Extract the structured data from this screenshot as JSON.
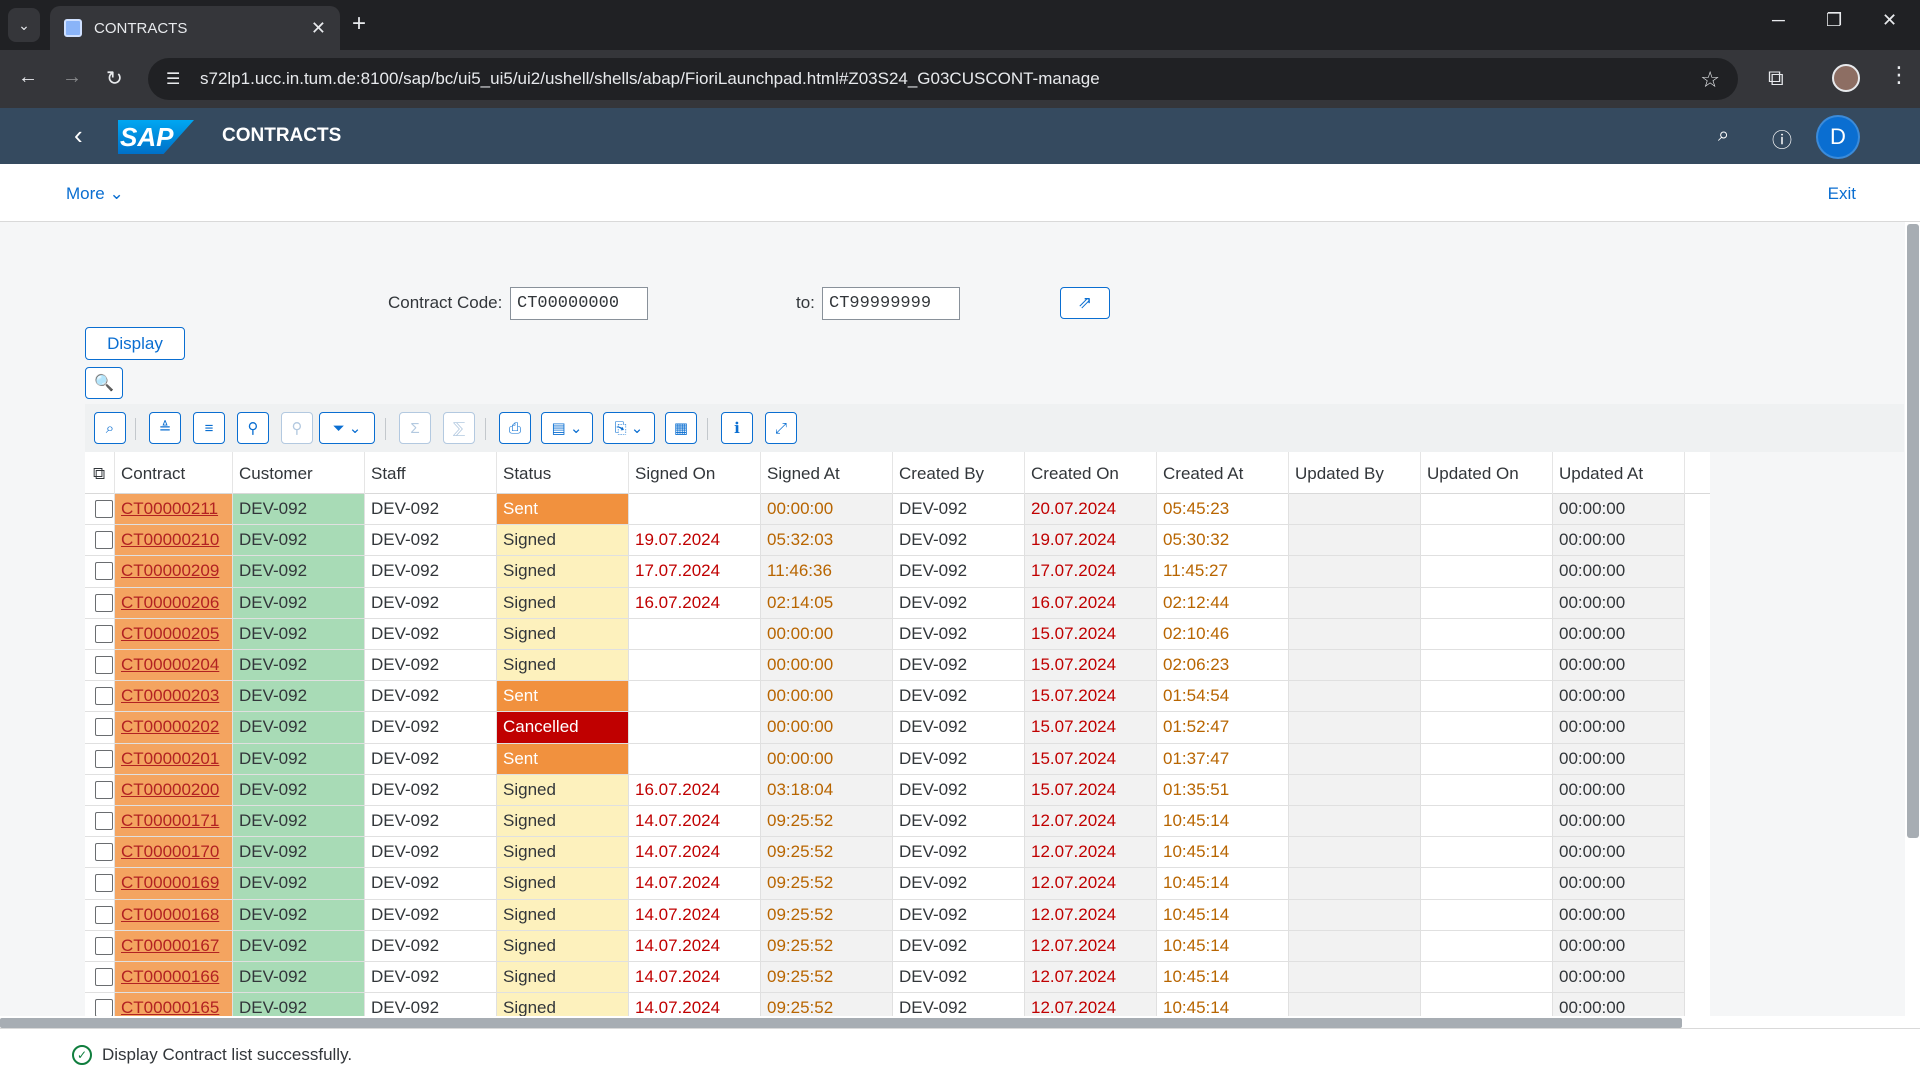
{
  "browser": {
    "tab_title": "CONTRACTS",
    "url": "s72lp1.ucc.in.tum.de:8100/sap/bc/ui5_ui5/ui2/ushell/shells/abap/FioriLaunchpad.html#Z03S24_G03CUSCONT-manage"
  },
  "shell": {
    "logo_text": "SAP",
    "title": "CONTRACTS",
    "avatar_initial": "D"
  },
  "subheader": {
    "more_label": "More",
    "exit_label": "Exit"
  },
  "selection": {
    "contract_code_label": "Contract Code:",
    "contract_from": "CT00000000",
    "to_label": "to:",
    "contract_to": "CT99999999",
    "display_button": "Display"
  },
  "grid": {
    "columns": [
      "Contract",
      "Customer",
      "Staff",
      "Status",
      "Signed On",
      "Signed At",
      "Created By",
      "Created On",
      "Created At",
      "Updated By",
      "Updated On",
      "Updated At"
    ],
    "rows": [
      [
        "CT00000211",
        "DEV-092",
        "DEV-092",
        "Sent",
        "",
        "00:00:00",
        "DEV-092",
        "20.07.2024",
        "05:45:23",
        "",
        "",
        "00:00:00"
      ],
      [
        "CT00000210",
        "DEV-092",
        "DEV-092",
        "Signed",
        "19.07.2024",
        "05:32:03",
        "DEV-092",
        "19.07.2024",
        "05:30:32",
        "",
        "",
        "00:00:00"
      ],
      [
        "CT00000209",
        "DEV-092",
        "DEV-092",
        "Signed",
        "17.07.2024",
        "11:46:36",
        "DEV-092",
        "17.07.2024",
        "11:45:27",
        "",
        "",
        "00:00:00"
      ],
      [
        "CT00000206",
        "DEV-092",
        "DEV-092",
        "Signed",
        "16.07.2024",
        "02:14:05",
        "DEV-092",
        "16.07.2024",
        "02:12:44",
        "",
        "",
        "00:00:00"
      ],
      [
        "CT00000205",
        "DEV-092",
        "DEV-092",
        "Signed",
        "",
        "00:00:00",
        "DEV-092",
        "15.07.2024",
        "02:10:46",
        "",
        "",
        "00:00:00"
      ],
      [
        "CT00000204",
        "DEV-092",
        "DEV-092",
        "Signed",
        "",
        "00:00:00",
        "DEV-092",
        "15.07.2024",
        "02:06:23",
        "",
        "",
        "00:00:00"
      ],
      [
        "CT00000203",
        "DEV-092",
        "DEV-092",
        "Sent",
        "",
        "00:00:00",
        "DEV-092",
        "15.07.2024",
        "01:54:54",
        "",
        "",
        "00:00:00"
      ],
      [
        "CT00000202",
        "DEV-092",
        "DEV-092",
        "Cancelled",
        "",
        "00:00:00",
        "DEV-092",
        "15.07.2024",
        "01:52:47",
        "",
        "",
        "00:00:00"
      ],
      [
        "CT00000201",
        "DEV-092",
        "DEV-092",
        "Sent",
        "",
        "00:00:00",
        "DEV-092",
        "15.07.2024",
        "01:37:47",
        "",
        "",
        "00:00:00"
      ],
      [
        "CT00000200",
        "DEV-092",
        "DEV-092",
        "Signed",
        "16.07.2024",
        "03:18:04",
        "DEV-092",
        "15.07.2024",
        "01:35:51",
        "",
        "",
        "00:00:00"
      ],
      [
        "CT00000171",
        "DEV-092",
        "DEV-092",
        "Signed",
        "14.07.2024",
        "09:25:52",
        "DEV-092",
        "12.07.2024",
        "10:45:14",
        "",
        "",
        "00:00:00"
      ],
      [
        "CT00000170",
        "DEV-092",
        "DEV-092",
        "Signed",
        "14.07.2024",
        "09:25:52",
        "DEV-092",
        "12.07.2024",
        "10:45:14",
        "",
        "",
        "00:00:00"
      ],
      [
        "CT00000169",
        "DEV-092",
        "DEV-092",
        "Signed",
        "14.07.2024",
        "09:25:52",
        "DEV-092",
        "12.07.2024",
        "10:45:14",
        "",
        "",
        "00:00:00"
      ],
      [
        "CT00000168",
        "DEV-092",
        "DEV-092",
        "Signed",
        "14.07.2024",
        "09:25:52",
        "DEV-092",
        "12.07.2024",
        "10:45:14",
        "",
        "",
        "00:00:00"
      ],
      [
        "CT00000167",
        "DEV-092",
        "DEV-092",
        "Signed",
        "14.07.2024",
        "09:25:52",
        "DEV-092",
        "12.07.2024",
        "10:45:14",
        "",
        "",
        "00:00:00"
      ],
      [
        "CT00000166",
        "DEV-092",
        "DEV-092",
        "Signed",
        "14.07.2024",
        "09:25:52",
        "DEV-092",
        "12.07.2024",
        "10:45:14",
        "",
        "",
        "00:00:00"
      ],
      [
        "CT00000165",
        "DEV-092",
        "DEV-092",
        "Signed",
        "14.07.2024",
        "09:25:52",
        "DEV-092",
        "12.07.2024",
        "10:45:14",
        "",
        "",
        "00:00:00"
      ]
    ]
  },
  "footer": {
    "message": "Display Contract list successfully."
  },
  "colors": {
    "shell_bg": "#354a5f",
    "accent": "#0a6ed1",
    "contract_cell": "#f4a460",
    "customer_cell": "#a8dbb6",
    "status_signed": "#fdf1bd",
    "status_sent": "#f1913e",
    "status_cancelled": "#c00000"
  }
}
